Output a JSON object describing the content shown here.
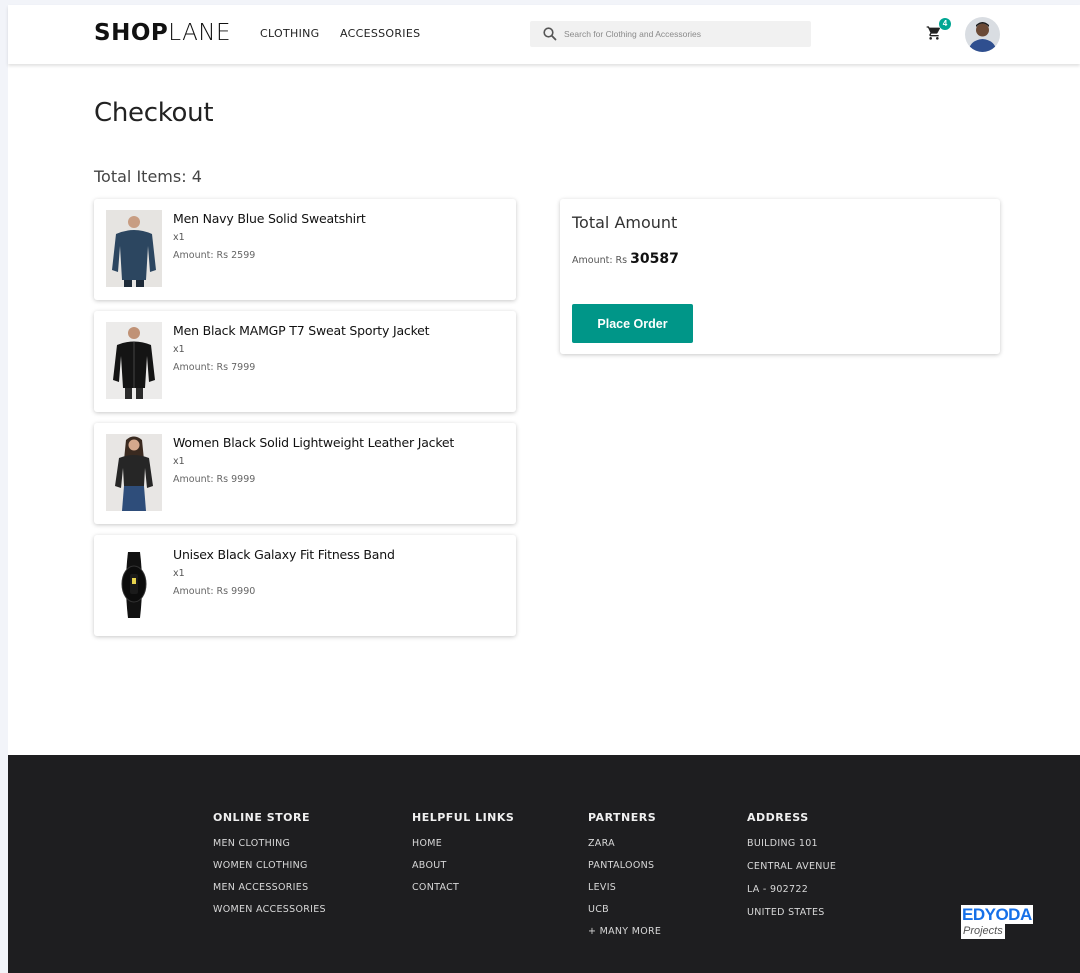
{
  "header": {
    "logo_bold": "SHOP",
    "logo_light": "LANE",
    "nav": [
      {
        "label": "CLOTHING"
      },
      {
        "label": "ACCESSORIES"
      }
    ],
    "search": {
      "placeholder": "Search for Clothing and Accessories"
    },
    "cart_count": "4"
  },
  "main": {
    "title": "Checkout",
    "total_items": "Total Items: 4",
    "items": [
      {
        "name": "Men Navy Blue Solid Sweatshirt",
        "qty": "x1",
        "amount_label": "Amount: Rs",
        "amount": "2599"
      },
      {
        "name": "Men Black MAMGP T7 Sweat Sporty Jacket",
        "qty": "x1",
        "amount_label": "Amount: Rs",
        "amount": "7999"
      },
      {
        "name": "Women Black Solid Lightweight Leather Jacket",
        "qty": "x1",
        "amount_label": "Amount: Rs",
        "amount": "9999"
      },
      {
        "name": "Unisex Black Galaxy Fit Fitness Band",
        "qty": "x1",
        "amount_label": "Amount: Rs",
        "amount": "9990"
      }
    ],
    "total": {
      "title": "Total Amount",
      "amount_label": "Amount: Rs",
      "amount": "30587",
      "button_label": "Place Order"
    }
  },
  "footer": {
    "columns": [
      {
        "heading": "ONLINE STORE",
        "links": [
          "MEN CLOTHING",
          "WOMEN CLOTHING",
          "MEN ACCESSORIES",
          "WOMEN ACCESSORIES"
        ]
      },
      {
        "heading": "HELPFUL LINKS",
        "links": [
          "HOME",
          "ABOUT",
          "CONTACT"
        ]
      },
      {
        "heading": "PARTNERS",
        "links": [
          "ZARA",
          "PANTALOONS",
          "LEVIS",
          "UCB",
          "+ MANY MORE"
        ]
      },
      {
        "heading": "ADDRESS",
        "lines": [
          "BUILDING 101",
          "CENTRAL AVENUE",
          "LA - 902722",
          "UNITED STATES"
        ]
      }
    ],
    "brand_top": "EDYODA",
    "brand_bottom": "Projects"
  },
  "colors": {
    "accent": "#009688",
    "badge": "#00a693",
    "footer_bg": "#1e1e20",
    "brand_blue": "#1670e8"
  }
}
